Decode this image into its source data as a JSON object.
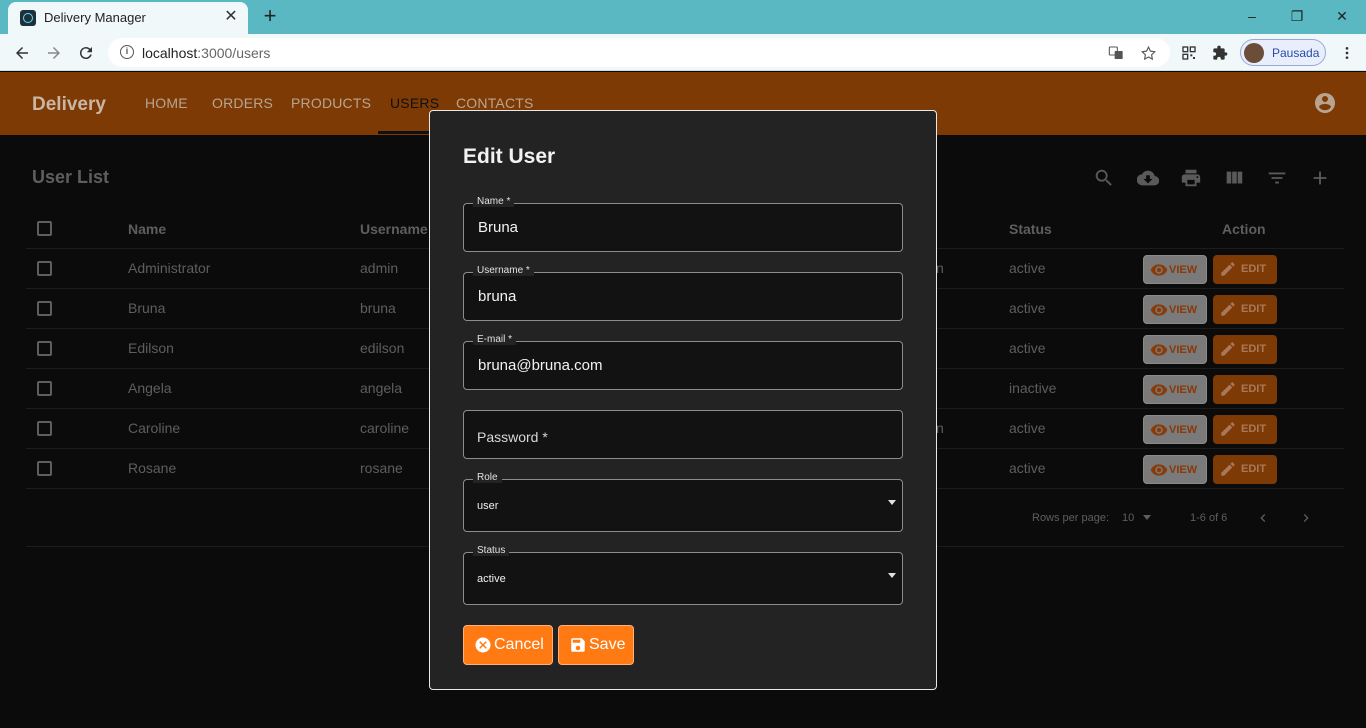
{
  "browser": {
    "tab_title": "Delivery Manager",
    "tab_close": "✕",
    "new_tab": "+",
    "url_host": "localhost",
    "url_rest": ":3000/users",
    "profile_name": "Pausada",
    "window_controls": [
      "–",
      "❐",
      "✕"
    ]
  },
  "app": {
    "brand": "Delivery",
    "nav": [
      "HOME",
      "ORDERS",
      "PRODUCTS",
      "USERS",
      "CONTACTS"
    ],
    "active_nav": "USERS",
    "list_title": "User List",
    "accent_color": "#ff7a12"
  },
  "table": {
    "headers": {
      "name": "Name",
      "username": "Username",
      "status": "Status",
      "action": "Action"
    },
    "rows": [
      {
        "name": "Administrator",
        "username": "admin",
        "partial": "n",
        "status": "active"
      },
      {
        "name": "Bruna",
        "username": "bruna",
        "partial": "",
        "status": "active"
      },
      {
        "name": "Edilson",
        "username": "edilson",
        "partial": "",
        "status": "active"
      },
      {
        "name": "Angela",
        "username": "angela",
        "partial": "",
        "status": "inactive"
      },
      {
        "name": "Caroline",
        "username": "caroline",
        "partial": "n",
        "status": "active"
      },
      {
        "name": "Rosane",
        "username": "rosane",
        "partial": "",
        "status": "active"
      }
    ],
    "view_label": "VIEW",
    "edit_label": "EDIT",
    "rows_per_page_label": "Rows per page:",
    "rows_per_page_value": "10",
    "range_label": "1-6 of 6"
  },
  "modal": {
    "title": "Edit User",
    "name_label": "Name *",
    "name_value": "Bruna",
    "username_label": "Username *",
    "username_value": "bruna",
    "email_label": "E-mail *",
    "email_value": "bruna@bruna.com",
    "password_placeholder": "Password *",
    "role_label": "Role",
    "role_value": "user",
    "status_label": "Status",
    "status_value": "active",
    "cancel_label": "Cancel",
    "save_label": "Save"
  }
}
